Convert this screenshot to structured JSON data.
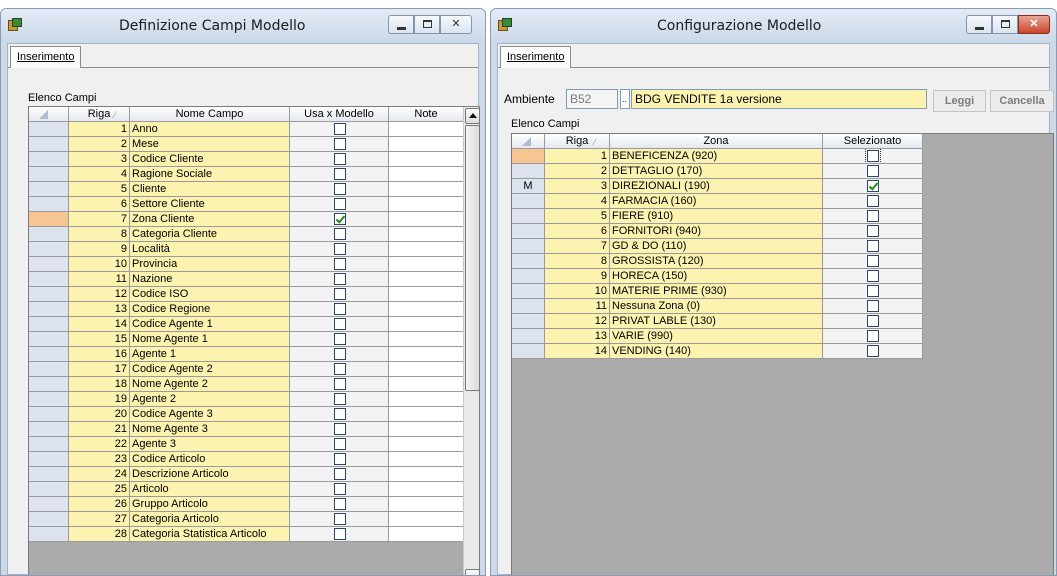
{
  "window_left": {
    "title": "Definizione Campi Modello",
    "tab": "Inserimento",
    "list_label": "Elenco Campi",
    "columns": [
      "Riga",
      "Nome Campo",
      "Usa x Modello",
      "Note"
    ],
    "rows": [
      {
        "num": "1",
        "name": "Anno",
        "checked": false
      },
      {
        "num": "2",
        "name": "Mese",
        "checked": false
      },
      {
        "num": "3",
        "name": "Codice Cliente",
        "checked": false
      },
      {
        "num": "4",
        "name": "Ragione Sociale",
        "checked": false
      },
      {
        "num": "5",
        "name": "Cliente",
        "checked": false
      },
      {
        "num": "6",
        "name": "Settore Cliente",
        "checked": false
      },
      {
        "num": "7",
        "name": "Zona Cliente",
        "checked": true
      },
      {
        "num": "8",
        "name": "Categoria Cliente",
        "checked": false
      },
      {
        "num": "9",
        "name": "Località",
        "checked": false
      },
      {
        "num": "10",
        "name": "Provincia",
        "checked": false
      },
      {
        "num": "11",
        "name": "Nazione",
        "checked": false
      },
      {
        "num": "12",
        "name": "Codice ISO",
        "checked": false
      },
      {
        "num": "13",
        "name": "Codice Regione",
        "checked": false
      },
      {
        "num": "14",
        "name": "Codice Agente 1",
        "checked": false
      },
      {
        "num": "15",
        "name": "Nome Agente 1",
        "checked": false
      },
      {
        "num": "16",
        "name": "Agente 1",
        "checked": false
      },
      {
        "num": "17",
        "name": "Codice Agente 2",
        "checked": false
      },
      {
        "num": "18",
        "name": "Nome Agente 2",
        "checked": false
      },
      {
        "num": "19",
        "name": "Agente 2",
        "checked": false
      },
      {
        "num": "20",
        "name": "Codice Agente 3",
        "checked": false
      },
      {
        "num": "21",
        "name": "Nome Agente 3",
        "checked": false
      },
      {
        "num": "22",
        "name": "Agente 3",
        "checked": false
      },
      {
        "num": "23",
        "name": "Codice Articolo",
        "checked": false
      },
      {
        "num": "24",
        "name": "Descrizione Articolo",
        "checked": false
      },
      {
        "num": "25",
        "name": "Articolo",
        "checked": false
      },
      {
        "num": "26",
        "name": "Gruppo Articolo",
        "checked": false
      },
      {
        "num": "27",
        "name": "Categoria Articolo",
        "checked": false
      },
      {
        "num": "28",
        "name": "Categoria Statistica Articolo",
        "checked": false
      }
    ],
    "current_row": 7
  },
  "window_right": {
    "title": "Configurazione Modello",
    "tab": "Inserimento",
    "ambiente_label": "Ambiente",
    "ambiente_code": "B52",
    "ambiente_dots": "..",
    "ambiente_desc": "BDG VENDITE 1a versione",
    "read_button": "Leggi",
    "delete_button": "Cancella",
    "list_label": "Elenco Campi",
    "columns": [
      "Riga",
      "Zona",
      "Selezionato"
    ],
    "rows": [
      {
        "num": "1",
        "name": "BENEFICENZA (920)",
        "checked": false,
        "marker": ""
      },
      {
        "num": "2",
        "name": "DETTAGLIO (170)",
        "checked": false,
        "marker": ""
      },
      {
        "num": "3",
        "name": "DIREZIONALI (190)",
        "checked": true,
        "marker": "M"
      },
      {
        "num": "4",
        "name": "FARMACIA (160)",
        "checked": false,
        "marker": ""
      },
      {
        "num": "5",
        "name": "FIERE (910)",
        "checked": false,
        "marker": ""
      },
      {
        "num": "6",
        "name": "FORNITORI (940)",
        "checked": false,
        "marker": ""
      },
      {
        "num": "7",
        "name": "GD & DO (110)",
        "checked": false,
        "marker": ""
      },
      {
        "num": "8",
        "name": "GROSSISTA (120)",
        "checked": false,
        "marker": ""
      },
      {
        "num": "9",
        "name": "HORECA (150)",
        "checked": false,
        "marker": ""
      },
      {
        "num": "10",
        "name": "MATERIE PRIME (930)",
        "checked": false,
        "marker": ""
      },
      {
        "num": "11",
        "name": "Nessuna Zona (0)",
        "checked": false,
        "marker": ""
      },
      {
        "num": "12",
        "name": "PRIVAT LABLE (130)",
        "checked": false,
        "marker": ""
      },
      {
        "num": "13",
        "name": "VARIE (990)",
        "checked": false,
        "marker": ""
      },
      {
        "num": "14",
        "name": "VENDING (140)",
        "checked": false,
        "marker": ""
      }
    ],
    "current_row": 1
  },
  "colors": {
    "name_cell": "#fdf3b0",
    "current_row": "#f6c592",
    "close_button": "#c9442a",
    "check": "#1f8a1f"
  }
}
